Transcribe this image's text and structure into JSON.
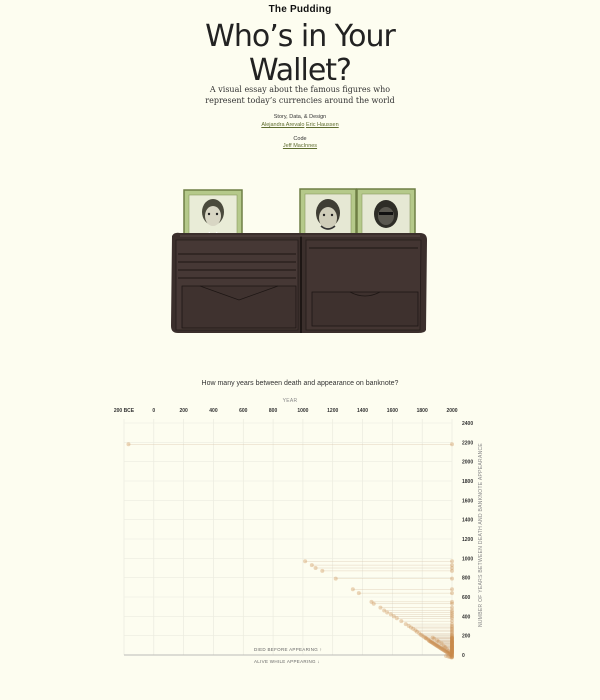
{
  "header": {
    "brand": "The Pudding",
    "title_line1": "Who’s in Your",
    "title_line2": "Wallet?",
    "subtitle": "A visual essay about the famous figures who represent today’s currencies around the world"
  },
  "credits": {
    "story_label": "Story, Data, & Design",
    "story_author1": "Alejandra Arevalo",
    "story_author2": "Eric Haussen",
    "code_label": "Code",
    "code_author": "Jeff MacInnes"
  },
  "illustration": {
    "wallet_color": "#3b2f2c",
    "note_color": "#b5c98a",
    "portraits": [
      "portrait-left",
      "portrait-middle",
      "portrait-right"
    ]
  },
  "chart_data": {
    "type": "scatter",
    "title": "How many years between death and appearance on banknote?",
    "xlabel": "YEAR",
    "ylabel": "NUMBER OF YEARS BETWEEN DEATH AND BANKNOTE APPEARANCE",
    "x_tick_labels": [
      "200 BCE",
      "0",
      "200",
      "400",
      "600",
      "800",
      "1000",
      "1200",
      "1400",
      "1600",
      "1800",
      "2000"
    ],
    "x_ticks": [
      -200,
      0,
      200,
      400,
      600,
      800,
      1000,
      1200,
      1400,
      1600,
      1800,
      2000
    ],
    "xlim": [
      -200,
      2000
    ],
    "y_ticks": [
      0,
      200,
      400,
      600,
      800,
      1000,
      1200,
      1400,
      1600,
      1800,
      2000,
      2200,
      2400
    ],
    "ylim": [
      0,
      2400
    ],
    "annotation_above": "DIED BEFORE APPEARING ↑",
    "annotation_below": "ALIVE WHILE APPEARING ↓",
    "point_color": "#c98a4b",
    "points": [
      {
        "x": -170,
        "y": 2180
      },
      {
        "x": 1015,
        "y": 970
      },
      {
        "x": 1060,
        "y": 930
      },
      {
        "x": 1085,
        "y": 900
      },
      {
        "x": 1130,
        "y": 870
      },
      {
        "x": 1220,
        "y": 790
      },
      {
        "x": 1335,
        "y": 680
      },
      {
        "x": 1375,
        "y": 640
      },
      {
        "x": 1460,
        "y": 550
      },
      {
        "x": 1475,
        "y": 530
      },
      {
        "x": 1520,
        "y": 490
      },
      {
        "x": 1545,
        "y": 460
      },
      {
        "x": 1565,
        "y": 440
      },
      {
        "x": 1590,
        "y": 420
      },
      {
        "x": 1610,
        "y": 400
      },
      {
        "x": 1630,
        "y": 380
      },
      {
        "x": 1660,
        "y": 350
      },
      {
        "x": 1690,
        "y": 320
      },
      {
        "x": 1710,
        "y": 300
      },
      {
        "x": 1725,
        "y": 285
      },
      {
        "x": 1740,
        "y": 270
      },
      {
        "x": 1755,
        "y": 255
      },
      {
        "x": 1765,
        "y": 240
      },
      {
        "x": 1780,
        "y": 225
      },
      {
        "x": 1790,
        "y": 210
      },
      {
        "x": 1800,
        "y": 200
      },
      {
        "x": 1810,
        "y": 190
      },
      {
        "x": 1820,
        "y": 180
      },
      {
        "x": 1825,
        "y": 175
      },
      {
        "x": 1830,
        "y": 170
      },
      {
        "x": 1840,
        "y": 160
      },
      {
        "x": 1845,
        "y": 150
      },
      {
        "x": 1850,
        "y": 145
      },
      {
        "x": 1855,
        "y": 140
      },
      {
        "x": 1860,
        "y": 135
      },
      {
        "x": 1865,
        "y": 130
      },
      {
        "x": 1870,
        "y": 125
      },
      {
        "x": 1875,
        "y": 120
      },
      {
        "x": 1880,
        "y": 115
      },
      {
        "x": 1885,
        "y": 110
      },
      {
        "x": 1890,
        "y": 105
      },
      {
        "x": 1895,
        "y": 100
      },
      {
        "x": 1900,
        "y": 95
      },
      {
        "x": 1905,
        "y": 90
      },
      {
        "x": 1910,
        "y": 85
      },
      {
        "x": 1915,
        "y": 80
      },
      {
        "x": 1920,
        "y": 75
      },
      {
        "x": 1925,
        "y": 70
      },
      {
        "x": 1930,
        "y": 65
      },
      {
        "x": 1935,
        "y": 60
      },
      {
        "x": 1940,
        "y": 55
      },
      {
        "x": 1945,
        "y": 50
      },
      {
        "x": 1950,
        "y": 45
      },
      {
        "x": 1955,
        "y": 40
      },
      {
        "x": 1960,
        "y": 35
      },
      {
        "x": 1965,
        "y": 30
      },
      {
        "x": 1970,
        "y": 25
      },
      {
        "x": 1975,
        "y": 20
      },
      {
        "x": 1980,
        "y": 15
      },
      {
        "x": 1985,
        "y": 10
      },
      {
        "x": 1990,
        "y": 5
      },
      {
        "x": 1995,
        "y": 0
      },
      {
        "x": 1960,
        "y": -10
      },
      {
        "x": 1975,
        "y": -15
      },
      {
        "x": 1985,
        "y": -20
      },
      {
        "x": 1995,
        "y": -25
      },
      {
        "x": 1930,
        "y": 120
      },
      {
        "x": 1945,
        "y": 90
      },
      {
        "x": 1955,
        "y": 80
      },
      {
        "x": 1965,
        "y": 60
      },
      {
        "x": 1975,
        "y": 40
      },
      {
        "x": 1985,
        "y": 30
      },
      {
        "x": 1900,
        "y": 150
      },
      {
        "x": 1910,
        "y": 140
      },
      {
        "x": 1880,
        "y": 170
      },
      {
        "x": 1870,
        "y": 180
      }
    ]
  }
}
